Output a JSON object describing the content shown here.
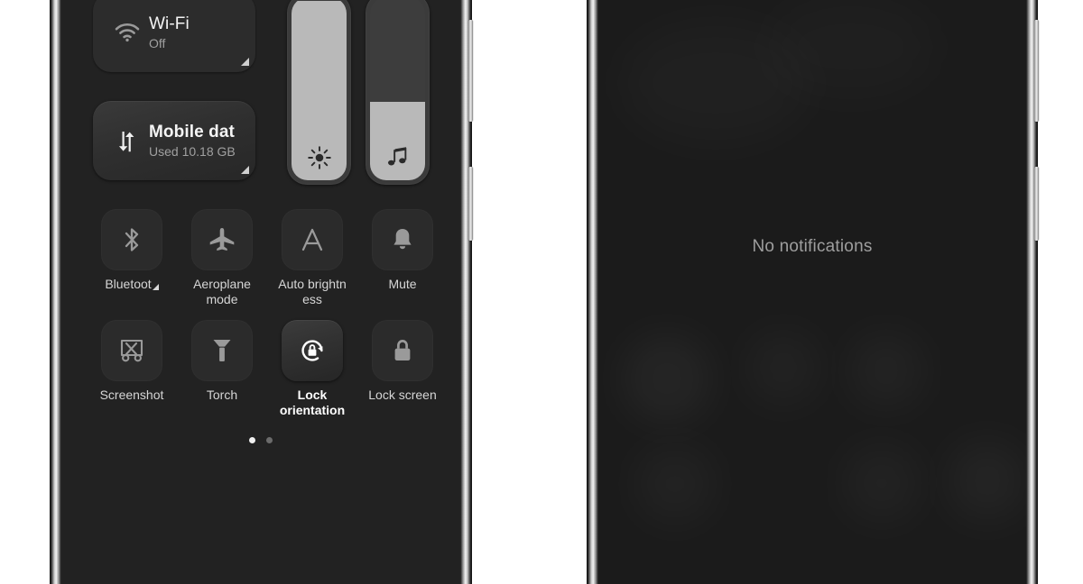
{
  "left_phone": {
    "name": "quick-settings-panel",
    "big_tiles": [
      {
        "id": "wifi",
        "icon": "wifi-icon",
        "title": "Wi-Fi",
        "subtitle": "Off",
        "active": false,
        "expand_affordance": true
      },
      {
        "id": "mobile-data",
        "icon": "mobile-data-icon",
        "title": "Mobile dat",
        "subtitle": "Used 10.18 GB",
        "active": true,
        "expand_affordance": true
      }
    ],
    "sliders": [
      {
        "id": "brightness",
        "icon": "brightness-sun-icon",
        "value": 98,
        "label": "Brightness"
      },
      {
        "id": "volume",
        "icon": "music-note-icon",
        "value": 43,
        "label": "Media volume"
      }
    ],
    "toggles": [
      {
        "id": "bluetooth",
        "icon": "bluetooth-icon",
        "label": "Bluetoot",
        "truncated": true,
        "active": false,
        "expand_affordance": true
      },
      {
        "id": "aeroplane-mode",
        "icon": "aeroplane-icon",
        "label": "Aeroplane mode",
        "active": false
      },
      {
        "id": "auto-brightness",
        "icon": "auto-brightness-a-icon",
        "label": "Auto brightness",
        "active": false
      },
      {
        "id": "mute",
        "icon": "bell-icon",
        "label": "Mute",
        "active": false
      },
      {
        "id": "screenshot",
        "icon": "screenshot-icon",
        "label": "Screenshot",
        "active": false
      },
      {
        "id": "torch",
        "icon": "torch-icon",
        "label": "Torch",
        "active": false
      },
      {
        "id": "lock-orientation",
        "icon": "rotation-lock-icon",
        "label": "Lock orientation",
        "active": true
      },
      {
        "id": "lock-screen",
        "icon": "padlock-icon",
        "label": "Lock screen",
        "active": false
      }
    ],
    "pagination": {
      "pages": 2,
      "current": 1
    }
  },
  "right_phone": {
    "name": "notification-shade",
    "empty_state": "No notifications"
  },
  "colors": {
    "panel_bg": "#222222",
    "tile_bg": "#2c2c2c",
    "tile_active_bg": "#3a3a3a",
    "slider_fill": "#b9b9b9",
    "slider_track": "#3d3d3d",
    "text_primary": "#f4f4f4",
    "text_secondary": "#a0a0a0",
    "icon_color": "#9a9a9a",
    "icon_active_color": "#ffffff",
    "right_screen_bg": "#1b1b1b",
    "page_bg": "#ffffff"
  }
}
